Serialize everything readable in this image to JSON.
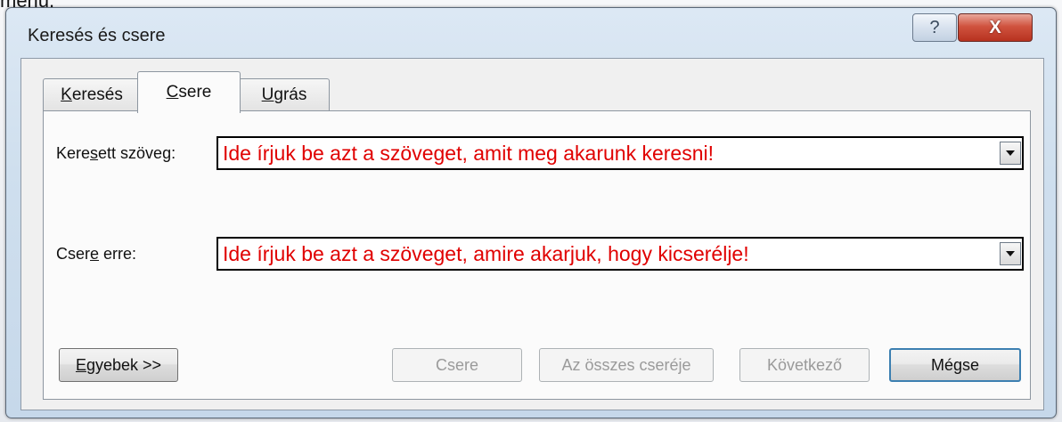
{
  "top_strip": {
    "text": "menü."
  },
  "window": {
    "title": "Keresés és csere",
    "help_label": "?",
    "close_label": "X"
  },
  "tabs": [
    {
      "label_pre": "",
      "label_u": "K",
      "label_post": "eresés"
    },
    {
      "label_pre": "",
      "label_u": "C",
      "label_post": "sere"
    },
    {
      "label_pre": "",
      "label_u": "U",
      "label_post": "grás"
    }
  ],
  "find": {
    "label_pre": "Kere",
    "label_u": "s",
    "label_post": "ett szöveg:",
    "value": "Ide írjuk be azt a szöveget, amit meg akarunk keresni!"
  },
  "replace": {
    "label_pre": "Cser",
    "label_u": "e",
    "label_post": " erre:",
    "value": "Ide írjuk be azt a szöveget, amire akarjuk, hogy kicserélje!"
  },
  "buttons": {
    "more_pre": "",
    "more_u": "E",
    "more_post": "gyebek >>",
    "replace": "Csere",
    "replace_all": "Az összes cseréje",
    "find_next": "Következő",
    "cancel": "Mégse"
  },
  "colors": {
    "field_text": "#e00000",
    "default_button_border": "#3c7fb1"
  }
}
